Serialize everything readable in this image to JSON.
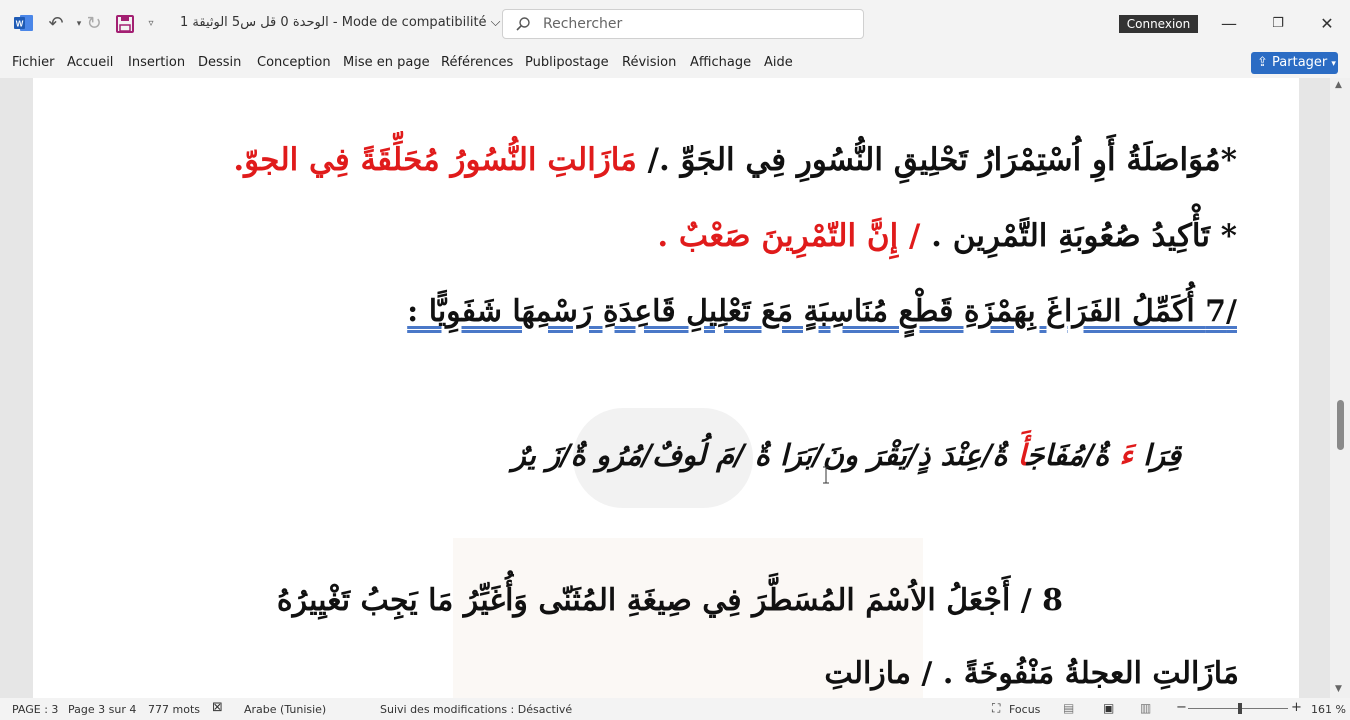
{
  "titlebar": {
    "doc_title": "الوحدة 0 قل س5 الوثيقة 1  -  Mode de compatibilité ⌵",
    "search_placeholder": "Rechercher",
    "signin_label": "Connexion",
    "icons": [
      "word-logo-icon",
      "undo-icon",
      "redo-icon",
      "save-icon",
      "customize-icon",
      "minimize-icon",
      "restore-icon",
      "close-icon"
    ]
  },
  "menu": {
    "items": [
      "Fichier",
      "Accueil",
      "Insertion",
      "Dessin",
      "Conception",
      "Mise en page",
      "Références",
      "Publipostage",
      "Révision",
      "Affichage",
      "Aide"
    ],
    "share_label": "Partager"
  },
  "document": {
    "line1_black": "*مُوَاصَلَةُ أَوِ اُسْتِمْرَارُ تَحْلِيقِ النُّسُورِ  فِي الجَوِّ ./ ",
    "line1_red": "مَازَالتِ النُّسُورُ مُحَلِّقَةً  فِي الجوّ.",
    "line2_black": "* تَأْكِيدُ صُعُوبَةِ التَّمْرِين . ",
    "line2_red": "/  إِنَّ التّمْرِينَ صَعْبٌ .",
    "line3": "/7  أُكَمِّلُ  الفَرَاغَ بِهَمْزَةِ قَطْعٍ مُنَاسِبَةٍ مَعَ تَعْلِيلِ قَاعِدَةِ رَسْمِهَا شَفَوِيًّا :",
    "line4_part1": "قِرَا ",
    "line4_red1": "ءَ",
    "line4_part2": " ةٌ/مُفَاجَ",
    "line4_red2": "أَ",
    "line4_part3": "  ةٌ/عِنْدَ  ذٍ/يَقْرَ  ونَ/بَرَا  ةٌ    /مَ لُوفٌ/مُرُو ةٌ/زَ   يرٌ",
    "line5": "8  /  أَجْعَلُ الاُسْمَ المُسَطَّرَ فِي صِيغَةِ  المُثَنّى وَأُغَيِّرُ مَا يَجِبُ تَغْيِيرُهُ",
    "line6": "مَازَالتِ العجلةُ  مَنْفُوخَةً  .    /    مازالتِ"
  },
  "statusbar": {
    "page_label": "PAGE : 3",
    "page_of": "Page 3 sur 4",
    "words": "777 mots",
    "language": "Arabe (Tunisie)",
    "track_changes": "Suivi des modifications : Désactivé",
    "focus_label": "Focus",
    "zoom_minus": "−",
    "zoom_plus": "+",
    "zoom_level": "161 %",
    "zoom_fraction": 0.52
  },
  "colors": {
    "accent": "#2b6cc4",
    "red_text": "#e01b1b",
    "underline": "#4a78c8"
  }
}
